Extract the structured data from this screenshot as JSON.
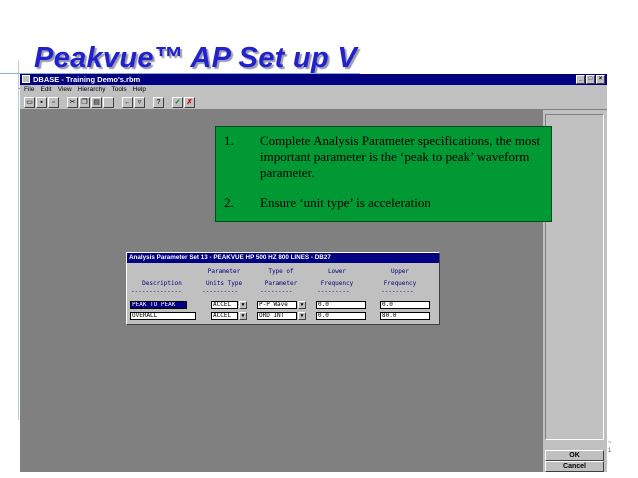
{
  "slide": {
    "title": "Peakvue™ AP Set up V"
  },
  "window": {
    "title": "DBASE - Training Demo's.rbm"
  },
  "menu": [
    "File",
    "Edit",
    "View",
    "Hierarchy",
    "Tools",
    "Help"
  ],
  "toolbar": {
    "icons": [
      "open-folder-icon",
      "save-disk-icon",
      "print-icon",
      "cut-icon",
      "copy-icon",
      "paste-icon",
      "blank-icon",
      "back-arrow-icon",
      "filter-icon",
      "help-icon",
      "apply-check-icon",
      "cancel-x-icon"
    ]
  },
  "callout": {
    "items": [
      {
        "num": "1.",
        "text": "Complete Analysis Parameter specifications, the most important parameter is the ‘peak to peak’ waveform parameter."
      },
      {
        "num": "2.",
        "text": "Ensure ‘unit type’ is acceleration"
      }
    ]
  },
  "dialog": {
    "title": "Analysis Parameter Set 13 - PEAKVUE HP 500 HZ 800 LINES - DB27",
    "headers": {
      "description": "Description",
      "param_units": "Parameter\nUnits Type",
      "type_of_param": "Type of\nParameter",
      "lower_freq": "Lower\nFrequency",
      "upper_freq": "Upper\nFrequency"
    },
    "rows": [
      {
        "description": "PEAK TO PEAK",
        "units": "ACCEL",
        "type": "P-P Wave",
        "lower": "0.0",
        "upper": "0.0"
      },
      {
        "description": "OVERALL",
        "units": "ACCEL",
        "type": "ORD INT",
        "lower": "0.0",
        "upper": "80.0"
      }
    ]
  },
  "buttons": {
    "ok": "OK",
    "cancel": "Cancel"
  },
  "edge_marks": [
    "~",
    "1"
  ]
}
